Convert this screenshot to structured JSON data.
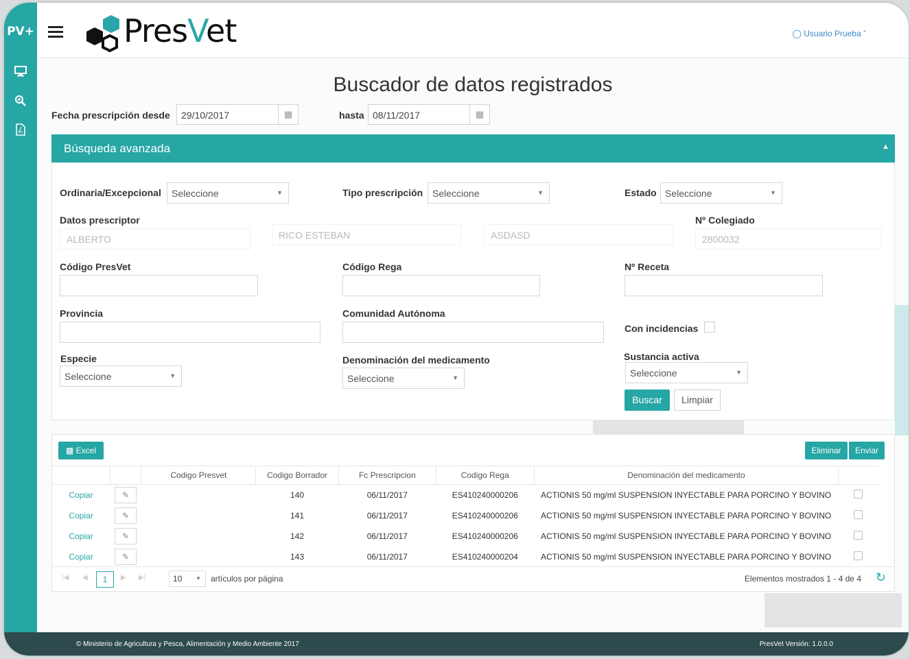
{
  "sidebar": {
    "brand": "PV+",
    "icons": [
      "monitor-icon",
      "search-zoom-icon",
      "pdf-icon"
    ]
  },
  "header": {
    "logo": "PresVet",
    "user": "Usuario Prueba"
  },
  "page": {
    "title": "Buscador de datos registrados"
  },
  "dates": {
    "from_label": "Fecha prescripción desde",
    "from_value": "29/10/2017",
    "to_label": "hasta",
    "to_value": "08/11/2017"
  },
  "advanced": {
    "title": "Búsqueda avanzada",
    "ordinaria_label": "Ordinaria/Excepcional",
    "ordinaria_value": "Seleccione",
    "tipo_label": "Tipo prescripción",
    "tipo_value": "Seleccione",
    "estado_label": "Estado",
    "estado_value": "Seleccione",
    "prescriptor_label": "Datos prescriptor",
    "prescriptor_nombre": "ALBERTO",
    "prescriptor_apellido1": "RICO ESTEBAN",
    "prescriptor_apellido2": "ASDASD",
    "colegiado_label": "Nº Colegiado",
    "colegiado_value": "2800032",
    "codigo_presvet_label": "Código PresVet",
    "codigo_rega_label": "Código Rega",
    "receta_label": "Nº Receta",
    "provincia_label": "Provincia",
    "comunidad_label": "Comunidad Autónoma",
    "incidencias_label": "Con incidencias",
    "especie_label": "Especie",
    "especie_value": "Seleccione",
    "denominacion_label": "Denominación del medicamento",
    "denominacion_value": "Seleccione",
    "sustancia_label": "Sustancia activa",
    "sustancia_value": "Seleccione",
    "buscar": "Buscar",
    "limpiar": "Limpiar"
  },
  "grid": {
    "excel": "Excel",
    "eliminar": "Eliminar",
    "enviar": "Enviar",
    "columns": [
      "Codigo Presvet",
      "Codigo Borrador",
      "Fc Prescripcion",
      "Codigo Rega",
      "Denominación del medicamento"
    ],
    "rows": [
      {
        "action": "Copiar",
        "presvet": "",
        "borrador": "140",
        "fecha": "06/11/2017",
        "rega": "ES410240000206",
        "medicamento": "ACTIONIS 50 mg/ml SUSPENSION INYECTABLE PARA PORCINO Y BOVINO"
      },
      {
        "action": "Copiar",
        "presvet": "",
        "borrador": "141",
        "fecha": "06/11/2017",
        "rega": "ES410240000206",
        "medicamento": "ACTIONIS 50 mg/ml SUSPENSION INYECTABLE PARA PORCINO Y BOVINO"
      },
      {
        "action": "Copiar",
        "presvet": "",
        "borrador": "142",
        "fecha": "06/11/2017",
        "rega": "ES410240000206",
        "medicamento": "ACTIONIS 50 mg/ml SUSPENSION INYECTABLE PARA PORCINO Y BOVINO"
      },
      {
        "action": "Copiar",
        "presvet": "",
        "borrador": "143",
        "fecha": "06/11/2017",
        "rega": "ES410240000204",
        "medicamento": "ACTIONIS 50 mg/ml SUSPENSION INYECTABLE PARA PORCINO Y BOVINO"
      }
    ],
    "pager": {
      "page": "1",
      "page_size": "10",
      "per_page_label": "artículos por página",
      "summary": "Elementos mostrados 1 - 4 de 4"
    }
  },
  "footer": {
    "left": "© Ministerio de Agricultura y Pesca, Alimentación y Medio Ambiente 2017",
    "right": "PresVet Versión: 1.0.0.0"
  },
  "colors": {
    "accent": "#26a6a5",
    "link": "#3a86c7",
    "footer": "#2d4a4d"
  }
}
